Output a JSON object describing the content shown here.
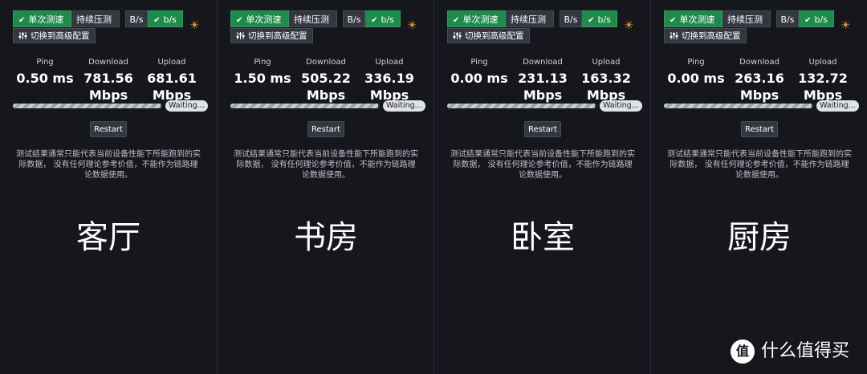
{
  "buttons": {
    "single_test": "单次测速",
    "continuous_test": "持续压测",
    "unit_bytes": "B/s",
    "unit_bits": "b/s",
    "advanced": "切换到高级配置",
    "restart": "Restart",
    "waiting": "Waiting..."
  },
  "labels": {
    "ping": "Ping",
    "download": "Download",
    "upload": "Upload"
  },
  "disclaimer": "测试结果通常只能代表当前设备性能下所能跑到的实际数据， 没有任何理论参考价值，不能作为链路理论数据使用。",
  "panels": [
    {
      "ping": "0.50 ms",
      "download": "781.56",
      "upload": "681.61",
      "unit": "Mbps",
      "progress": 0.99,
      "room": "客厅"
    },
    {
      "ping": "1.50 ms",
      "download": "505.22",
      "upload": "336.19",
      "unit": "Mbps",
      "progress": 0.99,
      "room": "书房"
    },
    {
      "ping": "0.00 ms",
      "download": "231.13",
      "upload": "163.32",
      "unit": "Mbps",
      "progress": 0.99,
      "room": "卧室"
    },
    {
      "ping": "0.00 ms",
      "download": "263.16",
      "upload": "132.72",
      "unit": "Mbps",
      "progress": 0.99,
      "room": "厨房"
    }
  ],
  "colors": {
    "accent_green": "#1f8a4c",
    "sun_orange": "#e6a12a",
    "background": "#16171d"
  },
  "icons": {
    "check": "check-icon",
    "settings": "sliders-icon",
    "theme": "sun-icon"
  },
  "watermark": {
    "logo_char": "值",
    "text": "什么值得买"
  }
}
